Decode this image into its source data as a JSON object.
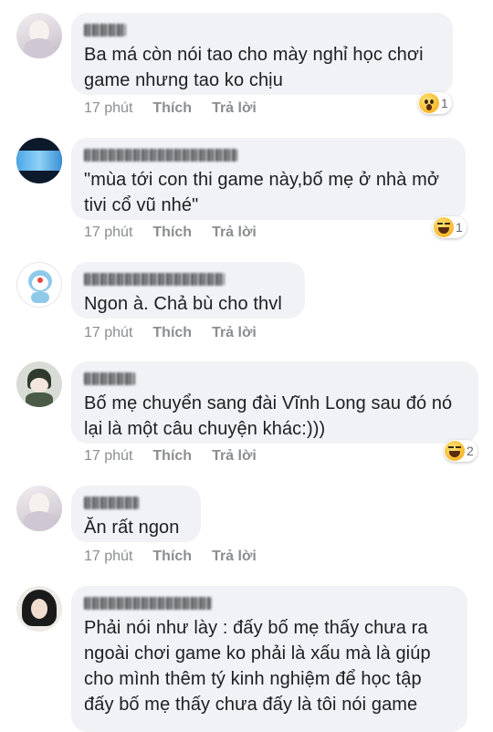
{
  "comments": [
    {
      "name": "Huy Tú",
      "text": "Ba má còn nói tao cho mày nghỉ học chơi\ngame nhưng tao ko chịu",
      "time": "17 phút",
      "like": "Thích",
      "reply": "Trả lời",
      "reaction": {
        "icon": "wow-emoji-icon",
        "count": "1"
      }
    },
    {
      "name": "Nguyễn Nguyễn Đức",
      "text": "\"mùa tới con thi game này,bố mẹ ở nhà mở\ntivi cổ vũ nhé\"",
      "time": "17 phút",
      "like": "Thích",
      "reply": "Trả lời",
      "reaction": {
        "icon": "haha-emoji-icon",
        "count": "1"
      }
    },
    {
      "name": "Huỳnh Thiên Huyền",
      "text": "Ngon à. Chả bù cho thvl",
      "time": "17 phút",
      "like": "Thích",
      "reply": "Trả lời"
    },
    {
      "name": "Vũ Đức",
      "text": "Bố mẹ chuyển sang đài Vĩnh Long sau đó nó\nlại là một câu chuyện khác:)))",
      "time": "17 phút",
      "like": "Thích",
      "reply": "Trả lời",
      "reaction": {
        "icon": "haha-emoji-icon",
        "count": "2"
      }
    },
    {
      "name": "Huy Tú",
      "text": "Ăn rất ngon",
      "time": "17 phút",
      "like": "Thích",
      "reply": "Trả lời"
    },
    {
      "name": "Trương Khánh Linh",
      "text": "Phải nói như lày : đấy bố mẹ thấy chưa ra\nngoài chơi game ko phải là xấu mà là giúp\ncho mình thêm tý kinh nghiệm để học tập\nđấy bố mẹ thấy chưa đấy là tôi nói game"
    }
  ]
}
